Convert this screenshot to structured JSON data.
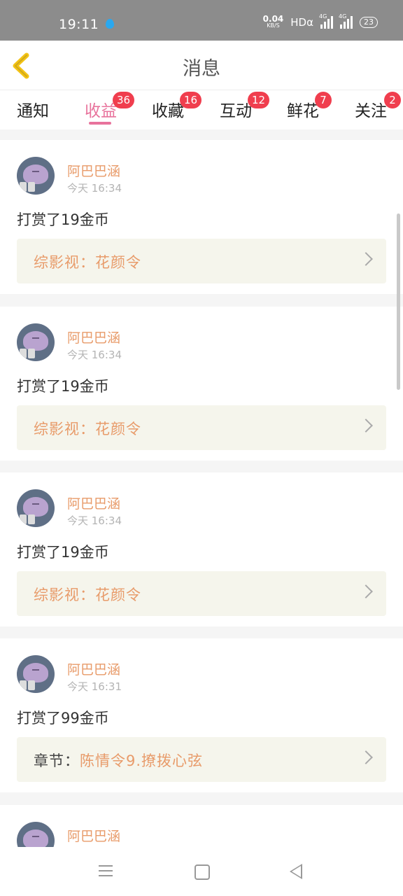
{
  "statusbar": {
    "time": "19:11",
    "speed": "0.04",
    "speed_unit": "KB/S",
    "hd": "HDα",
    "net1": "4G",
    "net2": "4G",
    "battery": "23"
  },
  "header": {
    "title": "消息"
  },
  "tabs": [
    {
      "label": "通知",
      "badge": ""
    },
    {
      "label": "收益",
      "badge": "36"
    },
    {
      "label": "收藏",
      "badge": "16"
    },
    {
      "label": "互动",
      "badge": "12"
    },
    {
      "label": "鲜花",
      "badge": "7"
    },
    {
      "label": "关注",
      "badge": "2"
    }
  ],
  "active_tab": "收益",
  "messages": [
    {
      "user": "阿巴巴涵",
      "time": "今天 16:34",
      "action": "打赏了19金币",
      "link_prefix": "",
      "link_text": "综影视：花颜令"
    },
    {
      "user": "阿巴巴涵",
      "time": "今天 16:34",
      "action": "打赏了19金币",
      "link_prefix": "",
      "link_text": "综影视：花颜令"
    },
    {
      "user": "阿巴巴涵",
      "time": "今天 16:34",
      "action": "打赏了19金币",
      "link_prefix": "",
      "link_text": "综影视：花颜令"
    },
    {
      "user": "阿巴巴涵",
      "time": "今天 16:31",
      "action": "打赏了99金币",
      "link_prefix": "章节：",
      "link_text": "陈情令9.撩拨心弦"
    },
    {
      "user": "阿巴巴涵",
      "time": "",
      "action": "",
      "link_prefix": "",
      "link_text": ""
    }
  ],
  "colors": {
    "accent": "#e8739c",
    "badge": "#f03e4e",
    "username": "#e89b6a",
    "back_arrow": "#f3c315"
  }
}
